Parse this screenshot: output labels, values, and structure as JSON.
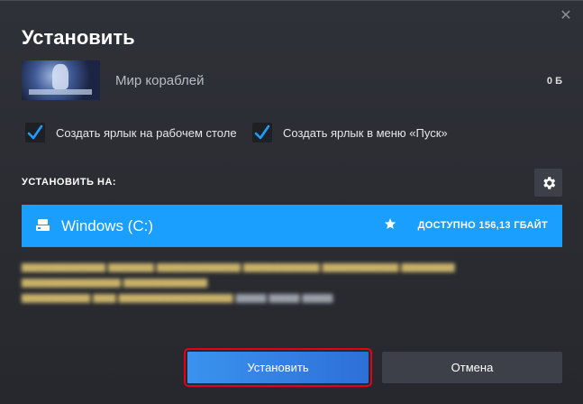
{
  "dialog": {
    "title": "Установить",
    "close_glyph": "✕"
  },
  "game": {
    "name": "Мир кораблей",
    "size": "0 Б"
  },
  "options": {
    "desktop_shortcut_label": "Создать ярлык на рабочем столе",
    "desktop_shortcut_checked": true,
    "start_menu_shortcut_label": "Создать ярлык в меню «Пуск»",
    "start_menu_shortcut_checked": true
  },
  "install_location": {
    "heading": "УСТАНОВИТЬ НА:",
    "drive_name": "Windows (C:)",
    "free_space": "ДОСТУПНО 156,13 ГБАЙТ",
    "settings_icon": "gear-icon"
  },
  "buttons": {
    "install_label": "Установить",
    "cancel_label": "Отмена"
  },
  "colors": {
    "accent": "#1a9fff",
    "install_button": "#3a93ee",
    "highlight_outline": "#e3001b",
    "background": "#2b2d33"
  }
}
